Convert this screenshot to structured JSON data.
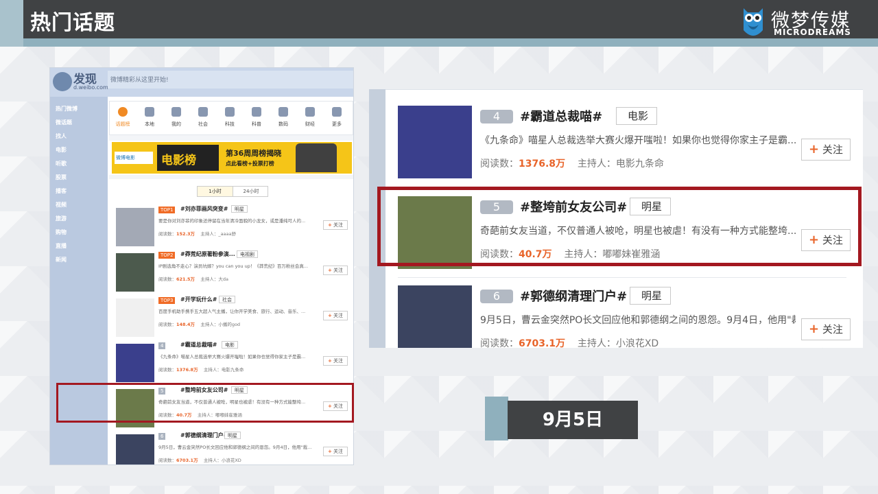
{
  "header": {
    "title": "热门话题"
  },
  "logo": {
    "cn": "微梦传媒",
    "en": "MICRODREAMS"
  },
  "left_shot": {
    "site_title": "发现",
    "site_sub": "d.weibo.com",
    "slogan": "微博精彩从这里开始!",
    "side_items": [
      "热门微博",
      "微话题",
      "找人",
      "电影",
      "听歌",
      "股票",
      "播客",
      "视频",
      "旅游",
      "购物",
      "直播",
      "新闻"
    ],
    "icons": [
      {
        "label": "话题榜",
        "icon": "flame-icon"
      },
      {
        "label": "本地",
        "icon": "pin-icon"
      },
      {
        "label": "我的",
        "icon": "user-icon"
      },
      {
        "label": "社会",
        "icon": "globe-icon"
      },
      {
        "label": "科技",
        "icon": "ie-icon"
      },
      {
        "label": "科普",
        "icon": "atom-icon"
      },
      {
        "label": "数码",
        "icon": "phone-icon"
      },
      {
        "label": "财经",
        "icon": "chart-icon"
      },
      {
        "label": "更多",
        "icon": "more-icon"
      }
    ],
    "banner": {
      "brand": "微博电影",
      "main": "电影榜",
      "line1": "第36周周榜揭晓",
      "line2": "点此看榜+投票打榜"
    },
    "tabs": [
      "1小时",
      "24小时"
    ],
    "rows": [
      {
        "rank": "TOP1",
        "topic": "#刘亦菲画风突变#",
        "cat": "明星",
        "desc": "要是你对刘亦菲的印象还停留在当年清冷面貌的小龙女，或是潘纯可人的...",
        "reads_label": "阅读数：",
        "reads": "152.3万",
        "host_label": "主持人：",
        "host": "_aaaa舒",
        "follow": "关注"
      },
      {
        "rank": "TOP2",
        "topic": "#莽荒纪原著粉参演...",
        "cat": "电视剧",
        "desc": "IP剧选角不走心？演员坑嫁？you can you up！《莽荒纪》百万粉丝会真...",
        "reads_label": "阅读数：",
        "reads": "621.5万",
        "host_label": "主持人：",
        "host": "大da",
        "follow": "关注"
      },
      {
        "rank": "TOP3",
        "topic": "#开学玩什么#",
        "cat": "社会",
        "desc": "百度手机助手携手五大超人气主播，让你开学美食、旅行、运动、音乐、...",
        "reads_label": "阅读数：",
        "reads": "148.4万",
        "host_label": "主持人：",
        "host": "小播的god",
        "follow": "关注"
      },
      {
        "rank": "4",
        "topic": "#霸道总裁喵#",
        "cat": "电影",
        "desc": "《九条命》喵星人总裁选举大赛火爆开嗤啦！如果你也觉得你家主子是霸...",
        "reads_label": "阅读数：",
        "reads": "1376.8万",
        "host_label": "主持人：",
        "host": "电影九条命",
        "follow": "关注"
      },
      {
        "rank": "5",
        "topic": "#整垮前女友公司#",
        "cat": "明星",
        "desc": "奇葩前女友当道，不仅普通人被呛，明星也被虐！有没有一种方式能整垮...",
        "reads_label": "阅读数：",
        "reads": "40.7万",
        "host_label": "主持人：",
        "host": "嘟嘟妹崔雅涵",
        "follow": "关注"
      },
      {
        "rank": "6",
        "topic": "#郭德纲清理门户#",
        "cat": "明星",
        "desc": "9月5日，曹云金突然PO长文回应他和郭德纲之间的恩怨。9月4日，他用\"裁...",
        "reads_label": "阅读数：",
        "reads": "6703.1万",
        "host_label": "主持人：",
        "host": "小浪花XD",
        "follow": "关注"
      }
    ]
  },
  "right_shot": {
    "rows": [
      {
        "rank": "4",
        "topic": "#霸道总裁喵#",
        "cat": "电影",
        "desc": "《九条命》喵星人总裁选举大赛火爆开嗤啦！如果你也觉得你家主子是霸...",
        "reads_label": "阅读数：",
        "reads": "1376.8万",
        "host_label": "主持人：",
        "host": "电影九条命",
        "follow": "关注"
      },
      {
        "rank": "5",
        "topic": "#整垮前女友公司#",
        "cat": "明星",
        "desc": "奇葩前女友当道，不仅普通人被呛，明星也被虐！有没有一种方式能整垮...",
        "reads_label": "阅读数：",
        "reads": "40.7万",
        "host_label": "主持人：",
        "host": "嘟嘟妹崔雅涵",
        "follow": "关注"
      },
      {
        "rank": "6",
        "topic": "#郭德纲清理门户#",
        "cat": "明星",
        "desc": "9月5日，曹云金突然PO长文回应他和郭德纲之间的恩怨。9月4日，他用\"裁...",
        "reads_label": "阅读数：",
        "reads": "6703.1万",
        "host_label": "主持人：",
        "host": "小浪花XD",
        "follow": "关注"
      }
    ]
  },
  "date_label": "9月5日",
  "colors": {
    "accent": "#e8642a",
    "highlight": "#a31820",
    "header": "#404244",
    "bar": "#8fb0bd"
  }
}
